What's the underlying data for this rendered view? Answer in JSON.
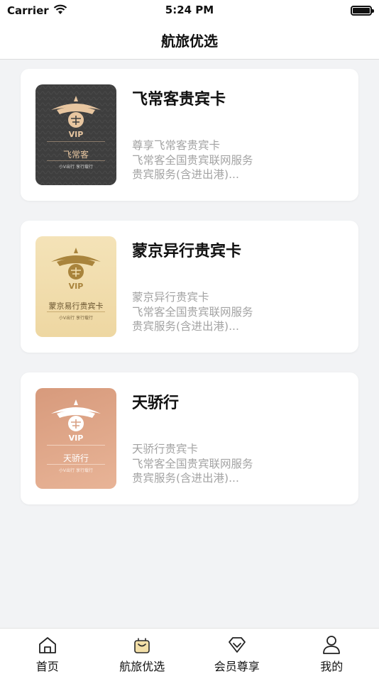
{
  "status_bar": {
    "carrier": "Carrier",
    "time": "5:24 PM"
  },
  "nav": {
    "title": "航旅优选"
  },
  "cards": [
    {
      "title": "飞常客贵宾卡",
      "lines": [
        "尊享飞常客贵宾卡",
        "飞常客全国贵宾联网服务",
        "贵宾服务(含进出港)..."
      ],
      "thumb_label": "飞常客",
      "thumb_badge": "VIP",
      "thumb_footer": "小V出行  享行载行",
      "thumb_bg": "#3e3e3e",
      "thumb_accent": "#e8c6a0"
    },
    {
      "title": "蒙京异行贵宾卡",
      "lines": [
        "蒙京异行贵宾卡",
        "飞常客全国贵宾联网服务",
        "贵宾服务(含进出港)..."
      ],
      "thumb_label": "蒙京易行贵宾卡",
      "thumb_badge": "VIP",
      "thumb_footer": "小V出行  享行载行",
      "thumb_bg": "#f1deb0",
      "thumb_accent": "#a9843c"
    },
    {
      "title": "天骄行",
      "lines": [
        "天骄行贵宾卡",
        "飞常客全国贵宾联网服务",
        "贵宾服务(含进出港)..."
      ],
      "thumb_label": "天骄行",
      "thumb_badge": "VIP",
      "thumb_footer": "小V出行  享行载行",
      "thumb_bg": "#dca486",
      "thumb_accent": "#ffffff"
    }
  ],
  "tabs": [
    {
      "label": "首页",
      "icon": "home-icon"
    },
    {
      "label": "航旅优选",
      "icon": "bag-icon",
      "active": true,
      "active_color": "#c9a45c"
    },
    {
      "label": "会员尊享",
      "icon": "diamond-icon"
    },
    {
      "label": "我的",
      "icon": "person-icon"
    }
  ]
}
